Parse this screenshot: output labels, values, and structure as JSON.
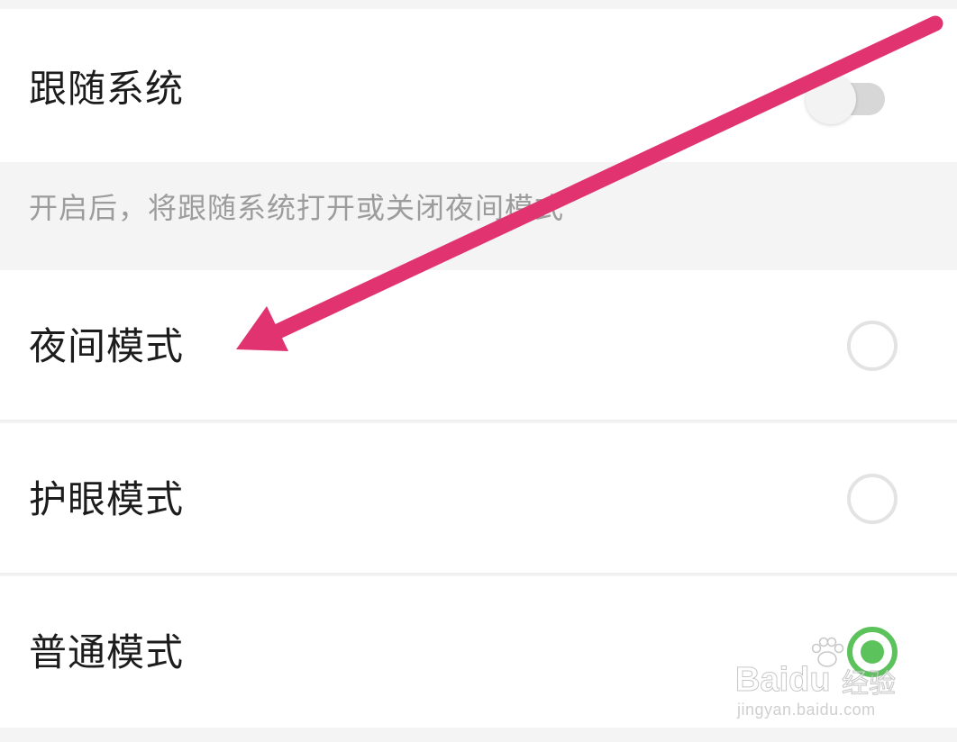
{
  "follow_system": {
    "label": "跟随系统",
    "enabled": false
  },
  "hint": {
    "text": "开启后，将跟随系统打开或关闭夜间模式"
  },
  "modes": [
    {
      "label": "夜间模式",
      "selected": false
    },
    {
      "label": "护眼模式",
      "selected": false
    },
    {
      "label": "普通模式",
      "selected": true
    }
  ],
  "annotation": {
    "arrow_color": "#e0336f",
    "target": "夜间模式"
  },
  "watermark": {
    "brand": "Baidu",
    "brand_suffix": "经验",
    "url": "jingyan.baidu.com",
    "icon": "paw-icon"
  },
  "colors": {
    "accent_green": "#5cc35c",
    "toggle_off": "#d7d7d7"
  }
}
